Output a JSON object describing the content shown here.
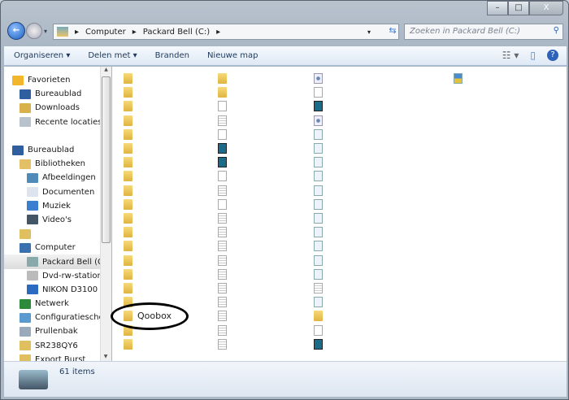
{
  "window": {
    "minimize": "–",
    "maximize": "□",
    "close": "X"
  },
  "address": {
    "crumbs": [
      "Computer",
      "Packard Bell (C:)"
    ],
    "separator": "▸"
  },
  "search": {
    "placeholder": "Zoeken in Packard Bell (C:)"
  },
  "toolbar": {
    "organize": "Organiseren ▾",
    "share": "Delen met ▾",
    "burn": "Branden",
    "new_folder": "Nieuwe map"
  },
  "sidebar": [
    {
      "label": "Favorieten",
      "icon": "star",
      "indent": 0
    },
    {
      "label": "Bureaublad",
      "icon": "desktop",
      "indent": 1
    },
    {
      "label": "Downloads",
      "icon": "downloads",
      "indent": 1
    },
    {
      "label": "Recente locaties",
      "icon": "recent",
      "indent": 1
    },
    {
      "label": "",
      "icon": "none",
      "indent": 0
    },
    {
      "label": "Bureaublad",
      "icon": "desktop",
      "indent": 0
    },
    {
      "label": "Bibliotheken",
      "icon": "library",
      "indent": 1
    },
    {
      "label": "Afbeeldingen",
      "icon": "pictures",
      "indent": 2
    },
    {
      "label": "Documenten",
      "icon": "documents",
      "indent": 2
    },
    {
      "label": "Muziek",
      "icon": "music",
      "indent": 2
    },
    {
      "label": "Video's",
      "icon": "video",
      "indent": 2
    },
    {
      "label": "",
      "icon": "user-folder",
      "indent": 1
    },
    {
      "label": "Computer",
      "icon": "computer",
      "indent": 1
    },
    {
      "label": "Packard Bell (C",
      "icon": "drive",
      "indent": 2,
      "selected": true
    },
    {
      "label": "Dvd-rw-station",
      "icon": "dvd",
      "indent": 2
    },
    {
      "label": "NIKON D3100 (",
      "icon": "sd",
      "indent": 2
    },
    {
      "label": "Netwerk",
      "icon": "network",
      "indent": 1
    },
    {
      "label": "Configuratiesche",
      "icon": "control-panel",
      "indent": 1
    },
    {
      "label": "Prullenbak",
      "icon": "recycle",
      "indent": 1
    },
    {
      "label": "SR238QY6",
      "icon": "folder",
      "indent": 1
    },
    {
      "label": "Export Burst",
      "icon": "folder",
      "indent": 1
    }
  ],
  "files": {
    "columns": [
      [
        "folder",
        "folder-lock",
        "folder",
        "folder",
        "folder",
        "folder",
        "folder",
        "folder",
        "folder",
        "folder",
        "folder",
        "folder",
        "folder",
        "folder",
        "folder",
        "folder",
        "folder",
        "folder",
        "folder-lock",
        "folder"
      ],
      [
        "folder",
        "folder",
        "doc",
        "txt",
        "font",
        "exe",
        "exe",
        "doc",
        "txt",
        "doc",
        "txt",
        "txt",
        "txt",
        "txt",
        "txt",
        "txt",
        "txt",
        "txt",
        "txt",
        "txt"
      ],
      [
        "gear",
        "font",
        "install",
        "gear",
        "sys",
        "sys",
        "sys",
        "sys",
        "sys",
        "sys",
        "sys",
        "sys",
        "sys",
        "sys",
        "sys",
        "txt",
        "config",
        "exe-yellow",
        "doc",
        "install"
      ],
      [
        "image"
      ]
    ],
    "highlighted": {
      "label": "Qoobox",
      "column": 0,
      "row": 17
    }
  },
  "status": {
    "count": "61 items"
  }
}
